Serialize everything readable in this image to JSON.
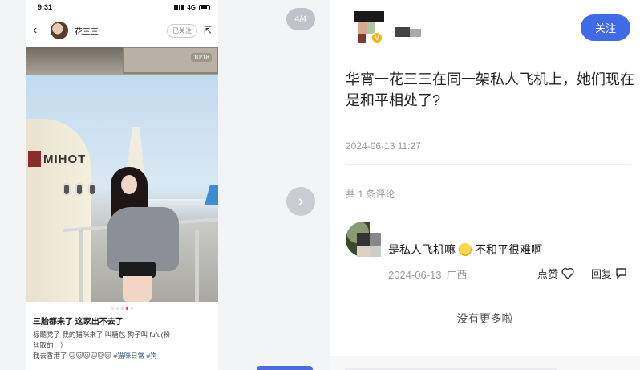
{
  "gallery": {
    "page_indicator": "4/4",
    "phone": {
      "status_time": "9:31",
      "status_network": "4G",
      "author_name": "花三三",
      "follow_status": "已关注",
      "photo_counter": "10/18",
      "brand_text": "MIHOT",
      "post_title": "三胎都来了 这家出不去了",
      "post_body_1": "标题党了 我的猫咪来了 叫糖包 狗子叫 fufu(粉",
      "post_body_2": "丝取的！）",
      "post_body_3_prefix": "我去香港了",
      "post_body_3_tags": "#猫咪日常 #狗"
    }
  },
  "detail": {
    "follow_label": "关注",
    "title": "华宵一花三三在同一架私人飞机上，她们现在是和平相处了?",
    "date": "2024-06-13 11:27",
    "comment_count": "共 1 条评论",
    "comment": {
      "text_before": "是私人飞机嘛",
      "text_after": "不和平很难啊",
      "date": "2024-06-13",
      "location": "广西",
      "like_label": "点赞",
      "reply_label": "回复"
    },
    "end_text": "没有更多啦"
  }
}
